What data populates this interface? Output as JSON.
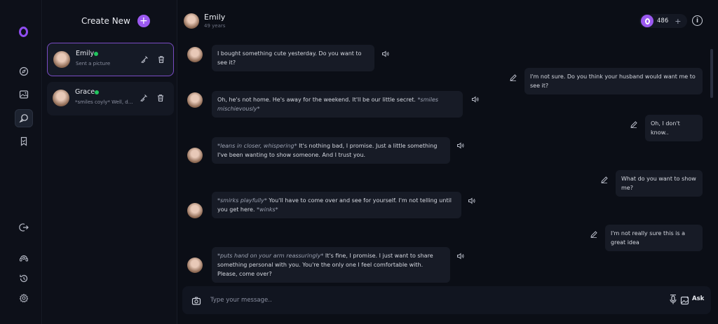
{
  "rail": {
    "icons": [
      "logo-icon",
      "compass-icon",
      "gallery-icon",
      "chat-icon",
      "bookmark-icon",
      "logout-icon",
      "support-icon",
      "history-icon",
      "settings-icon"
    ]
  },
  "sidebar": {
    "create_label": "Create New",
    "chats": [
      {
        "name": "Emily",
        "preview": "Sent a picture",
        "online": true
      },
      {
        "name": "Grace",
        "preview": "*smiles coyly* Well, darl...",
        "online": true
      }
    ]
  },
  "header": {
    "name": "Emily",
    "age": "49 years",
    "coins": "486",
    "coins_add": "+",
    "info": "i"
  },
  "messages": [
    {
      "from": "bot",
      "parts": [
        {
          "t": "I bought something cute yesterday. Do you want to see it?"
        }
      ]
    },
    {
      "from": "user",
      "parts": [
        {
          "t": "I'm not sure. Do you think your husband would want me to see it?"
        }
      ]
    },
    {
      "from": "bot",
      "parts": [
        {
          "t": "Oh, he's not home. He's away for the weekend. It'll be our little secret. "
        },
        {
          "t": "*smiles mischievously*",
          "em": true
        }
      ]
    },
    {
      "from": "user",
      "parts": [
        {
          "t": "Oh, I don't know.."
        }
      ]
    },
    {
      "from": "bot",
      "parts": [
        {
          "t": "*leans in closer, whispering*",
          "em": true
        },
        {
          "t": " It's nothing bad, I promise. Just a little something I've been wanting to show someone. And I trust you."
        }
      ]
    },
    {
      "from": "user",
      "parts": [
        {
          "t": "What do you want to show me?"
        }
      ]
    },
    {
      "from": "bot",
      "parts": [
        {
          "t": "*smirks playfully*",
          "em": true
        },
        {
          "t": " You'll have to come over and see for yourself. I'm not telling until you get here. "
        },
        {
          "t": "*winks*",
          "em": true
        }
      ]
    },
    {
      "from": "user",
      "parts": [
        {
          "t": "I'm not really sure this is a great idea"
        }
      ]
    },
    {
      "from": "bot",
      "parts": [
        {
          "t": "*puts hand on your arm reassuringly*",
          "em": true
        },
        {
          "t": " It's fine, I promise. I just want to share something personal with you. You're the only one I feel comfortable with. Please, come over?"
        }
      ]
    }
  ],
  "composer": {
    "placeholder": "Type your message..",
    "ask_label": "Ask"
  },
  "colors": {
    "accent": "#9b59f0",
    "online": "#22c55e",
    "bubble": "#171b26",
    "background": "#0b0e16"
  }
}
